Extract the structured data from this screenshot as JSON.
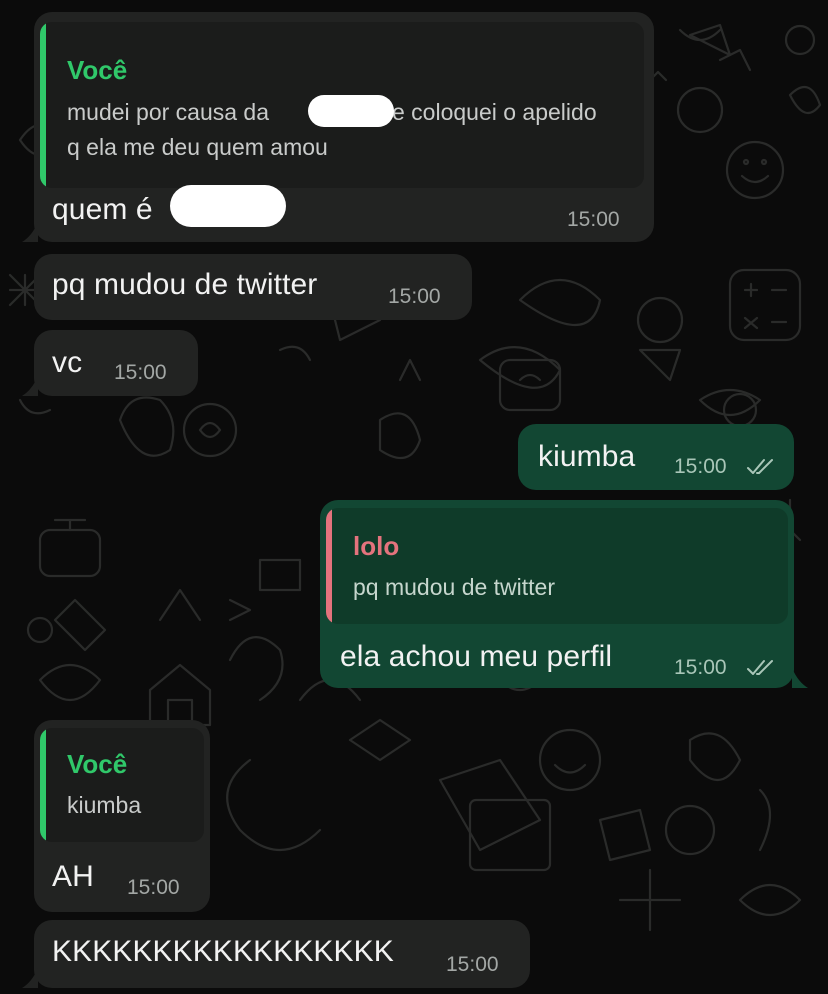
{
  "colors": {
    "incoming_bubble": "#222322",
    "outgoing_bubble": "#124733",
    "reply_you": "#30c86a",
    "reply_lolo": "#e4737d"
  },
  "messages": [
    {
      "direction": "in",
      "reply": {
        "author": "Você",
        "lines": [
          "mudei por causa da",
          "e coloquei o apelido",
          "q ela me deu quem amou"
        ]
      },
      "text": "quem é",
      "time": "15:00"
    },
    {
      "direction": "in",
      "text": "pq mudou de twitter",
      "time": "15:00"
    },
    {
      "direction": "in",
      "text": "vc",
      "time": "15:00"
    },
    {
      "direction": "out",
      "text": "kiumba",
      "time": "15:00",
      "status": "read-ticks-icon"
    },
    {
      "direction": "out",
      "reply": {
        "author": "lolo",
        "lines": [
          "pq mudou de twitter"
        ]
      },
      "text": "ela achou meu perfil",
      "time": "15:00",
      "status": "read-ticks-icon"
    },
    {
      "direction": "in",
      "reply": {
        "author": "Você",
        "lines": [
          "kiumba"
        ]
      },
      "text": "AH",
      "time": "15:00"
    },
    {
      "direction": "in",
      "text": "KKKKKKKKKKKKKKKKK",
      "time": "15:00"
    }
  ]
}
